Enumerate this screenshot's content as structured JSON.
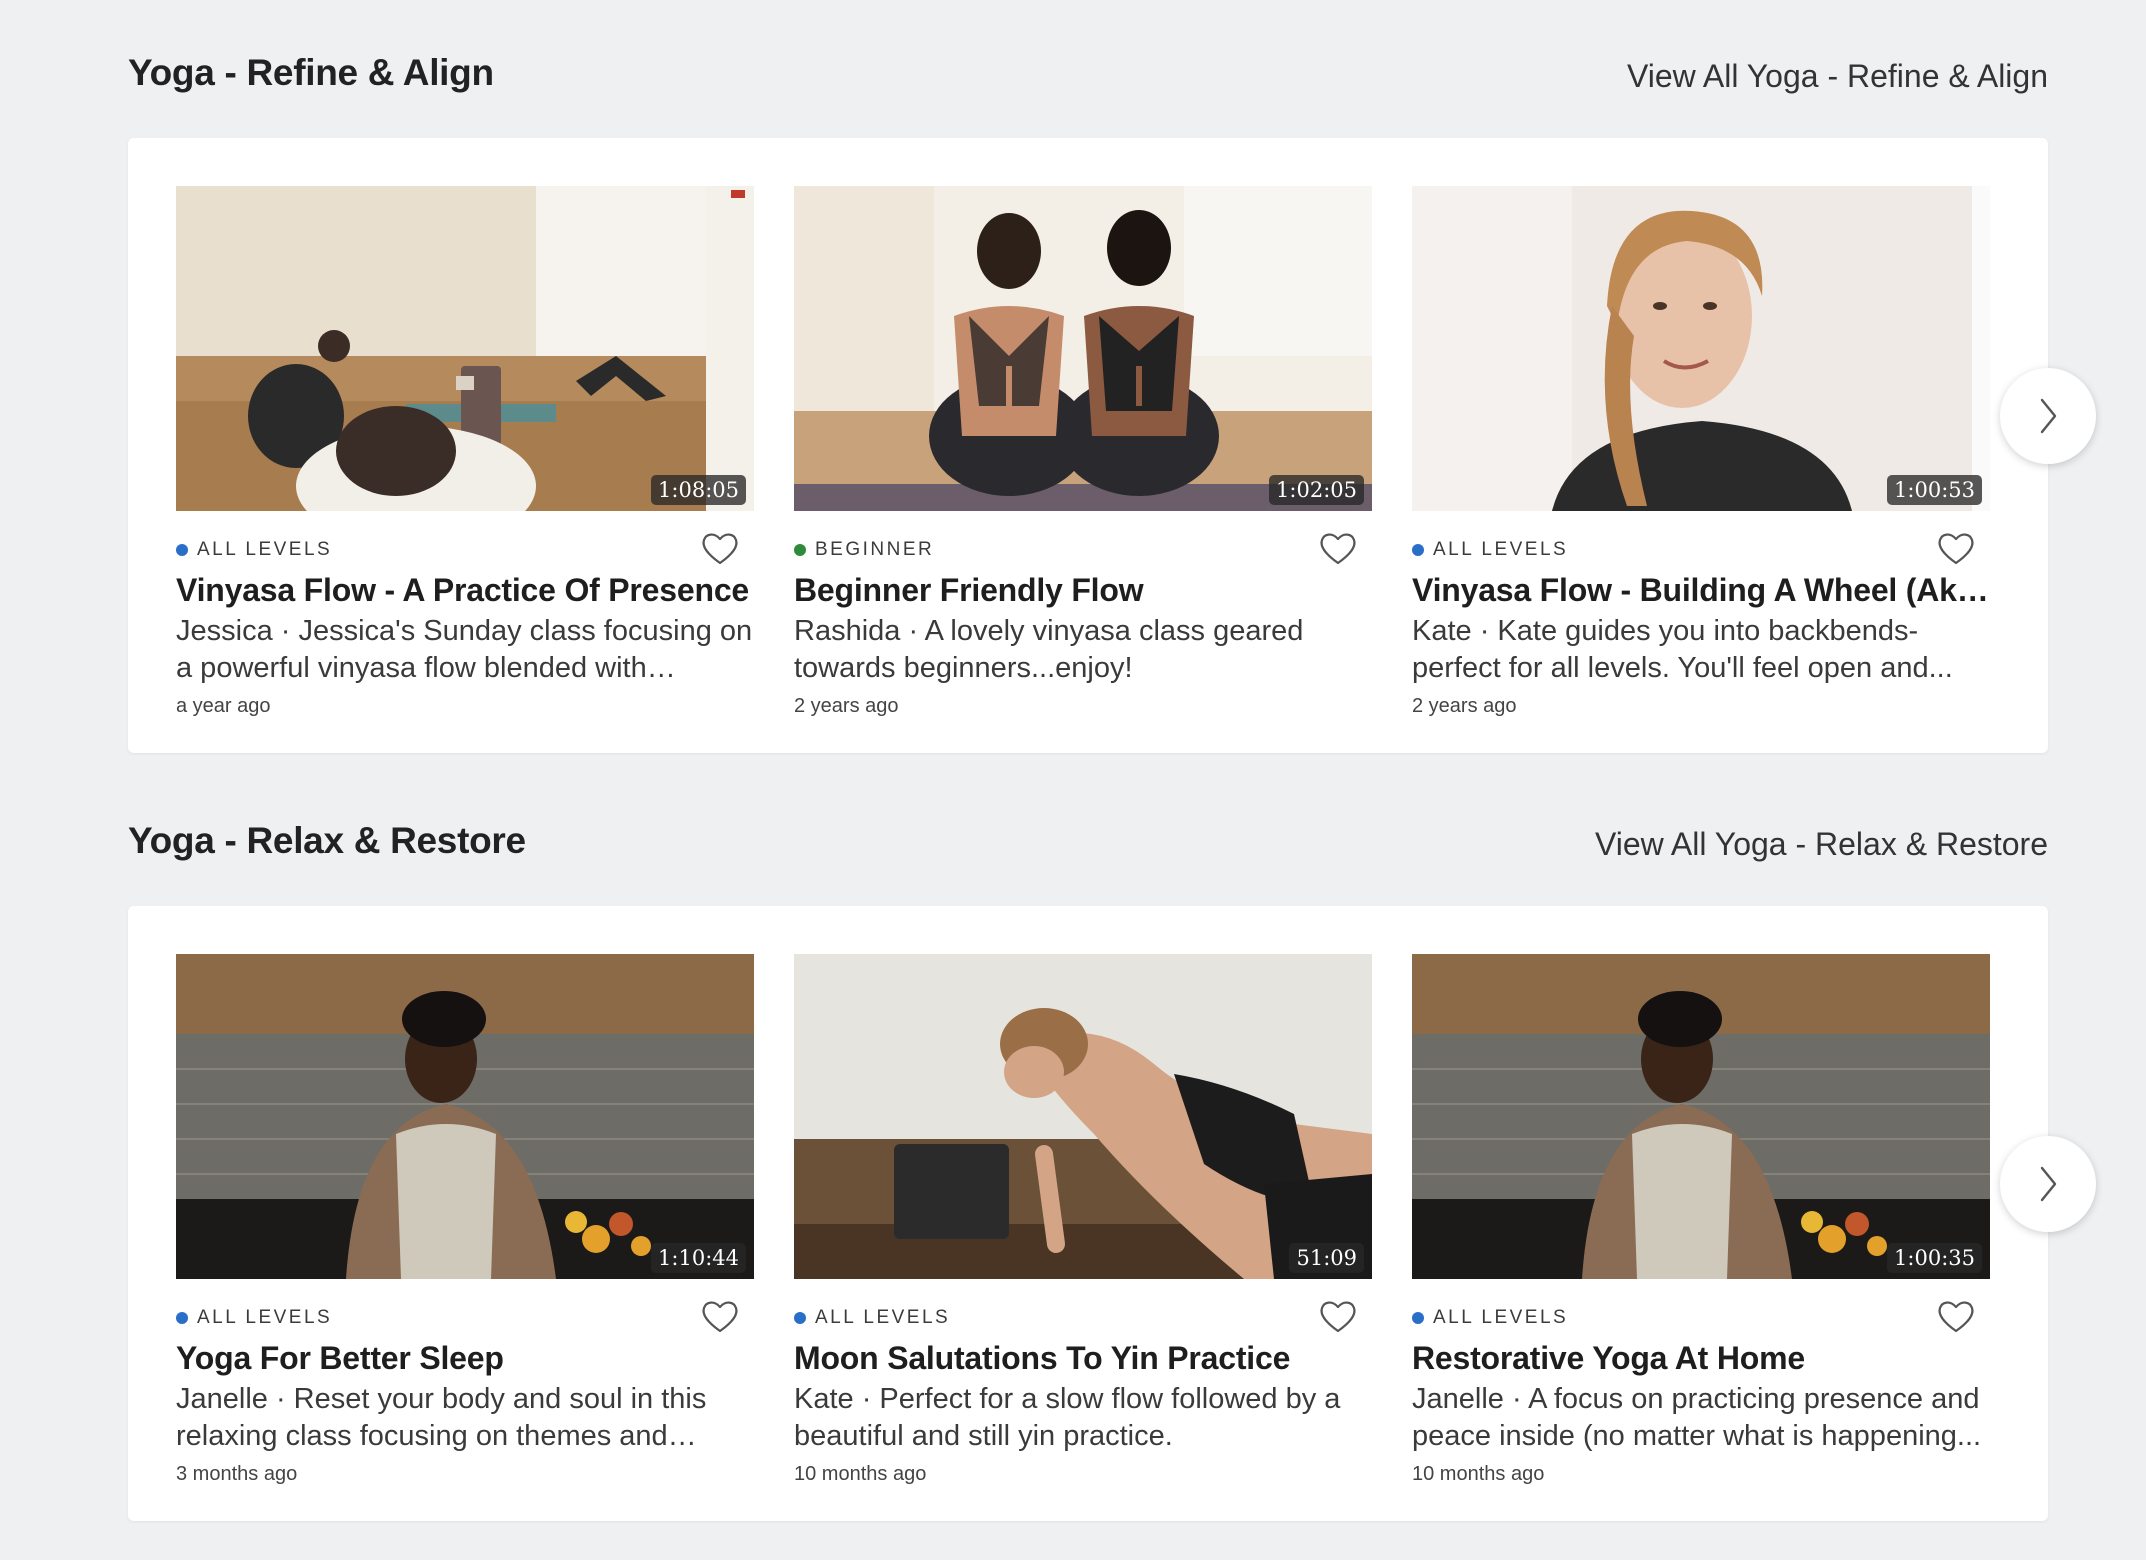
{
  "sections": [
    {
      "title": "Yoga - Refine & Align",
      "view_all": "View All Yoga - Refine & Align",
      "cards": [
        {
          "duration": "1:08:05",
          "level": "ALL LEVELS",
          "level_color": "#2a6fc7",
          "title": "Vinyasa Flow - A Practice Of Presence",
          "description": "Jessica · Jessica's Sunday class focusing on a powerful vinyasa flow blended with yoga's...",
          "age": "a year ago"
        },
        {
          "duration": "1:02:05",
          "level": "BEGINNER",
          "level_color": "#2f8a3a",
          "title": "Beginner Friendly Flow",
          "description": "Rashida · A lovely vinyasa class geared towards beginners...enjoy!",
          "age": "2 years ago"
        },
        {
          "duration": "1:00:53",
          "level": "ALL LEVELS",
          "level_color": "#2a6fc7",
          "title": "Vinyasa Flow - Building A Wheel (Aka -...",
          "description": "Kate · Kate guides you into backbends- perfect for all levels. You'll feel open and...",
          "age": "2 years ago"
        }
      ]
    },
    {
      "title": "Yoga - Relax & Restore",
      "view_all": "View All Yoga - Relax & Restore",
      "cards": [
        {
          "duration": "1:10:44",
          "level": "ALL LEVELS",
          "level_color": "#2a6fc7",
          "title": "Yoga For Better Sleep",
          "description": "Janelle · Reset your body and soul in this relaxing class focusing on themes and pose...",
          "age": "3 months ago"
        },
        {
          "duration": "51:09",
          "level": "ALL LEVELS",
          "level_color": "#2a6fc7",
          "title": "Moon Salutations To Yin Practice",
          "description": "Kate · Perfect for a slow flow followed by a beautiful and still yin practice.",
          "age": "10 months ago"
        },
        {
          "duration": "1:00:35",
          "level": "ALL LEVELS",
          "level_color": "#2a6fc7",
          "title": "Restorative Yoga At Home",
          "description": "Janelle · A focus on practicing presence and peace inside (no matter what is happening...",
          "age": "10 months ago"
        }
      ]
    }
  ],
  "icons": {
    "favorite": "heart-outline-icon",
    "next": "chevron-right-icon"
  }
}
